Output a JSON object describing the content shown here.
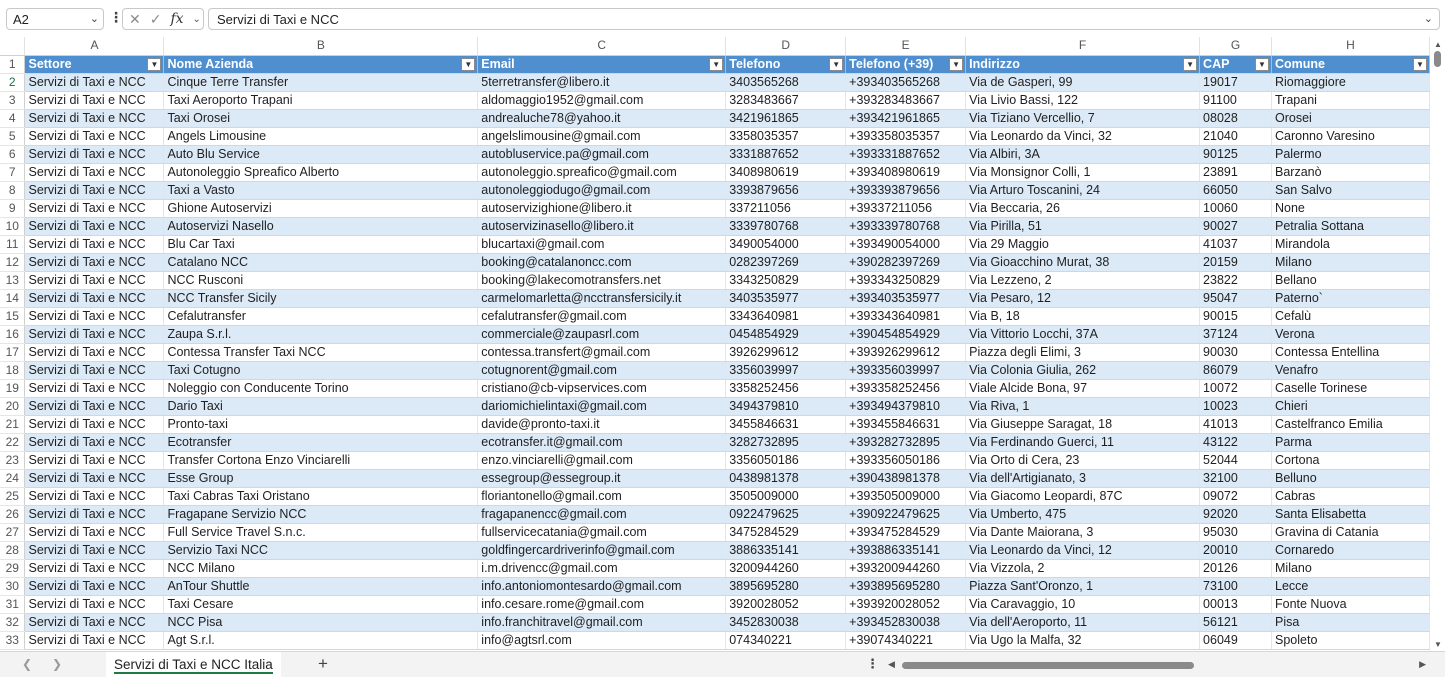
{
  "formula_bar": {
    "name_box": "A2",
    "formula": "Servizi di Taxi e NCC",
    "fx_label": "fx"
  },
  "columns": [
    "A",
    "B",
    "C",
    "D",
    "E",
    "F",
    "G",
    "H"
  ],
  "header_row": {
    "row_number": "1",
    "cells": [
      "Settore",
      "Nome Azienda",
      "Email",
      "Telefono",
      "Telefono (+39)",
      "Indirizzo",
      "CAP",
      "Comune"
    ]
  },
  "rows": [
    [
      "2",
      "Servizi di Taxi e NCC",
      "Cinque Terre Transfer",
      "5terretransfer@libero.it",
      "3403565268",
      "+393403565268",
      "Via de Gasperi, 99",
      "19017",
      "Riomaggiore"
    ],
    [
      "3",
      "Servizi di Taxi e NCC",
      "Taxi Aeroporto Trapani",
      "aldomaggio1952@gmail.com",
      "3283483667",
      "+393283483667",
      "Via Livio Bassi, 122",
      "91100",
      "Trapani"
    ],
    [
      "4",
      "Servizi di Taxi e NCC",
      "Taxi Orosei",
      "andrealuche78@yahoo.it",
      "3421961865",
      "+393421961865",
      "Via Tiziano Vercellio, 7",
      "08028",
      "Orosei"
    ],
    [
      "5",
      "Servizi di Taxi e NCC",
      "Angels Limousine",
      "angelslimousine@gmail.com",
      "3358035357",
      "+393358035357",
      "Via Leonardo da Vinci, 32",
      "21040",
      "Caronno Varesino"
    ],
    [
      "6",
      "Servizi di Taxi e NCC",
      "Auto Blu Service",
      "autobluservice.pa@gmail.com",
      "3331887652",
      "+393331887652",
      "Via Albiri, 3A",
      "90125",
      "Palermo"
    ],
    [
      "7",
      "Servizi di Taxi e NCC",
      "Autonoleggio Spreafico Alberto",
      "autonoleggio.spreafico@gmail.com",
      "3408980619",
      "+393408980619",
      "Via Monsignor Colli, 1",
      "23891",
      "Barzanò"
    ],
    [
      "8",
      "Servizi di Taxi e NCC",
      "Taxi a Vasto",
      "autonoleggiodugo@gmail.com",
      "3393879656",
      "+393393879656",
      "Via Arturo Toscanini, 24",
      "66050",
      "San Salvo"
    ],
    [
      "9",
      "Servizi di Taxi e NCC",
      "Ghione Autoservizi",
      "autoservizighione@libero.it",
      "337211056",
      "+39337211056",
      "Via Beccaria, 26",
      "10060",
      "None"
    ],
    [
      "10",
      "Servizi di Taxi e NCC",
      "Autoservizi Nasello",
      "autoservizinasello@libero.it",
      "3339780768",
      "+393339780768",
      "Via Pirilla, 51",
      "90027",
      "Petralia Sottana"
    ],
    [
      "11",
      "Servizi di Taxi e NCC",
      "Blu Car Taxi",
      "blucartaxi@gmail.com",
      "3490054000",
      "+393490054000",
      "Via 29 Maggio",
      "41037",
      "Mirandola"
    ],
    [
      "12",
      "Servizi di Taxi e NCC",
      "Catalano NCC",
      "booking@catalanoncc.com",
      "0282397269",
      "+390282397269",
      "Via Gioacchino Murat, 38",
      "20159",
      "Milano"
    ],
    [
      "13",
      "Servizi di Taxi e NCC",
      "NCC Rusconi",
      "booking@lakecomotransfers.net",
      "3343250829",
      "+393343250829",
      "Via Lezzeno, 2",
      "23822",
      "Bellano"
    ],
    [
      "14",
      "Servizi di Taxi e NCC",
      "NCC Transfer Sicily",
      "carmelomarletta@ncctransfersicily.it",
      "3403535977",
      "+393403535977",
      "Via Pesaro, 12",
      "95047",
      "Paterno`"
    ],
    [
      "15",
      "Servizi di Taxi e NCC",
      "Cefalutransfer",
      "cefalutransfer@gmail.com",
      "3343640981",
      "+393343640981",
      "Via B, 18",
      "90015",
      "Cefalù"
    ],
    [
      "16",
      "Servizi di Taxi e NCC",
      "Zaupa S.r.l.",
      "commerciale@zaupasrl.com",
      "0454854929",
      "+390454854929",
      "Via Vittorio Locchi, 37A",
      "37124",
      "Verona"
    ],
    [
      "17",
      "Servizi di Taxi e NCC",
      "Contessa Transfer Taxi NCC",
      "contessa.transfert@gmail.com",
      "3926299612",
      "+393926299612",
      "Piazza degli Elimi, 3",
      "90030",
      "Contessa Entellina"
    ],
    [
      "18",
      "Servizi di Taxi e NCC",
      "Taxi Cotugno",
      "cotugnorent@gmail.com",
      "3356039997",
      "+393356039997",
      "Via Colonia Giulia, 262",
      "86079",
      "Venafro"
    ],
    [
      "19",
      "Servizi di Taxi e NCC",
      "Noleggio con Conducente Torino",
      "cristiano@cb-vipservices.com",
      "3358252456",
      "+393358252456",
      "Viale Alcide Bona, 97",
      "10072",
      "Caselle Torinese"
    ],
    [
      "20",
      "Servizi di Taxi e NCC",
      "Dario Taxi",
      "dariomichielintaxi@gmail.com",
      "3494379810",
      "+393494379810",
      "Via Riva, 1",
      "10023",
      "Chieri"
    ],
    [
      "21",
      "Servizi di Taxi e NCC",
      "Pronto-taxi",
      "davide@pronto-taxi.it",
      "3455846631",
      "+393455846631",
      "Via Giuseppe Saragat, 18",
      "41013",
      "Castelfranco Emilia"
    ],
    [
      "22",
      "Servizi di Taxi e NCC",
      "Ecotransfer",
      "ecotransfer.it@gmail.com",
      "3282732895",
      "+393282732895",
      "Via Ferdinando Guerci, 11",
      "43122",
      "Parma"
    ],
    [
      "23",
      "Servizi di Taxi e NCC",
      "Transfer Cortona Enzo Vinciarelli",
      "enzo.vinciarelli@gmail.com",
      "3356050186",
      "+393356050186",
      "Via Orto di Cera, 23",
      "52044",
      "Cortona"
    ],
    [
      "24",
      "Servizi di Taxi e NCC",
      "Esse Group",
      "essegroup@essegroup.it",
      "0438981378",
      "+390438981378",
      "Via dell'Artigianato, 3",
      "32100",
      "Belluno"
    ],
    [
      "25",
      "Servizi di Taxi e NCC",
      "Taxi Cabras Taxi Oristano",
      "floriantonello@gmail.com",
      "3505009000",
      "+393505009000",
      "Via Giacomo Leopardi, 87C",
      "09072",
      "Cabras"
    ],
    [
      "26",
      "Servizi di Taxi e NCC",
      "Fragapane Servizio NCC",
      "fragapanencc@gmail.com",
      "0922479625",
      "+390922479625",
      "Via Umberto, 475",
      "92020",
      "Santa Elisabetta"
    ],
    [
      "27",
      "Servizi di Taxi e NCC",
      "Full Service Travel S.n.c.",
      "fullservicecatania@gmail.com",
      "3475284529",
      "+393475284529",
      "Via Dante Maiorana, 3",
      "95030",
      "Gravina di Catania"
    ],
    [
      "28",
      "Servizi di Taxi e NCC",
      "Servizio Taxi NCC",
      "goldfingercardriverinfo@gmail.com",
      "3886335141",
      "+393886335141",
      "Via Leonardo da Vinci, 12",
      "20010",
      "Cornaredo"
    ],
    [
      "29",
      "Servizi di Taxi e NCC",
      "NCC Milano",
      "i.m.drivencc@gmail.com",
      "3200944260",
      "+393200944260",
      "Via Vizzola, 2",
      "20126",
      "Milano"
    ],
    [
      "30",
      "Servizi di Taxi e NCC",
      "AnTour Shuttle",
      "info.antoniomontesardo@gmail.com",
      "3895695280",
      "+393895695280",
      "Piazza Sant'Oronzo, 1",
      "73100",
      "Lecce"
    ],
    [
      "31",
      "Servizi di Taxi e NCC",
      "Taxi Cesare",
      "info.cesare.rome@gmail.com",
      "3920028052",
      "+393920028052",
      "Via Caravaggio, 10",
      "00013",
      "Fonte Nuova"
    ],
    [
      "32",
      "Servizi di Taxi e NCC",
      "NCC Pisa",
      "info.franchitravel@gmail.com",
      "3452830038",
      "+393452830038",
      "Via dell'Aeroporto, 11",
      "56121",
      "Pisa"
    ],
    [
      "33",
      "Servizi di Taxi e NCC",
      "Agt S.r.l.",
      "info@agtsrl.com",
      "074340221",
      "+39074340221",
      "Via Ugo la Malfa, 32",
      "06049",
      "Spoleto"
    ]
  ],
  "sheet_tabs": [
    "Servizi di Taxi e NCC Italia"
  ],
  "colors": {
    "header_bg": "#4f8fcf",
    "band_bg": "#dce9f6",
    "tab_accent": "#1f7a45"
  }
}
